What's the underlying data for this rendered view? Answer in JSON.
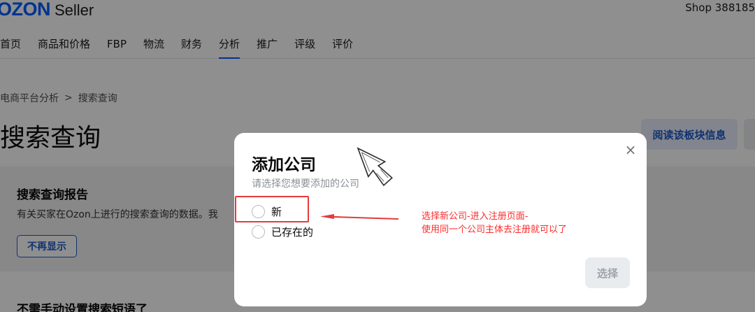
{
  "header": {
    "logo_brand": "OZON",
    "logo_product": "Seller",
    "shop": "Shop 388185"
  },
  "nav": {
    "items": [
      {
        "label": "首页"
      },
      {
        "label": "商品和价格"
      },
      {
        "label": "FBP"
      },
      {
        "label": "物流"
      },
      {
        "label": "财务"
      },
      {
        "label": "分析"
      },
      {
        "label": "推广"
      },
      {
        "label": "评级"
      },
      {
        "label": "评价"
      }
    ],
    "active": "分析"
  },
  "breadcrumb": {
    "parent": "电商平台分析",
    "separator": ">",
    "current": "搜索查询"
  },
  "page": {
    "title": "搜索查询",
    "read_button": "阅读该板块信息"
  },
  "report_card": {
    "title": "搜索查询报告",
    "text": "有关买家在Ozon上进行的搜索查询的数据。我",
    "dismiss_button": "不再显示"
  },
  "second_card": {
    "title": "不需手动设置搜索短语了"
  },
  "modal": {
    "title": "添加公司",
    "subtitle": "请选择您想要添加的公司",
    "options": [
      {
        "label": "新",
        "selected": false
      },
      {
        "label": "已存在的",
        "selected": false
      }
    ],
    "submit_button": "选择",
    "close_symbol": "×"
  },
  "annotation": {
    "line1": "选择新公司-进入注册页面-",
    "line2": "使用同一个公司主体去注册就可以了",
    "color": "#ff2a2a"
  },
  "colors": {
    "brand": "#005bff",
    "link": "#1f59c8",
    "overlay": "rgba(0,0,0,0.44)"
  },
  "icons": [
    "close-icon",
    "chevron-right-icon",
    "radio-icon",
    "cursor-icon",
    "arrow-icon"
  ]
}
